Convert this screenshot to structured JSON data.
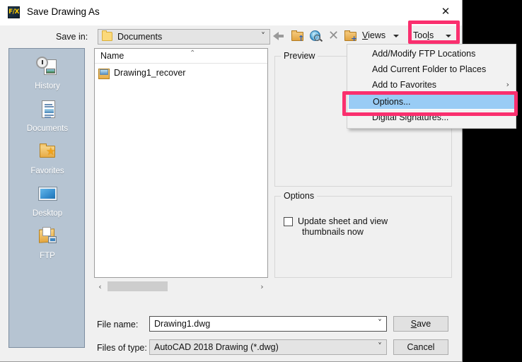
{
  "window": {
    "title": "Save Drawing As",
    "icon": "autocad-fx-icon",
    "close_label": "✕"
  },
  "saveIn": {
    "label": "Save in:",
    "value": "Documents",
    "chevron": "˅"
  },
  "toolbar": {
    "icons": [
      {
        "name": "back-icon",
        "title": "Back"
      },
      {
        "name": "up-one-level-icon",
        "title": "Up one level"
      },
      {
        "name": "search-web-icon",
        "title": "Search the Web"
      },
      {
        "name": "delete-icon",
        "title": "Delete"
      },
      {
        "name": "create-new-folder-icon",
        "title": "Create New Folder"
      }
    ],
    "views_label": "Views",
    "views_label_underline": "V",
    "views_label_rest": "iews",
    "tools_label": "Tools",
    "tools_label_pre": "Too",
    "tools_label_underline": "l",
    "tools_label_post": "s"
  },
  "places": {
    "items": [
      {
        "label": "History",
        "icon": "history-icon"
      },
      {
        "label": "Documents",
        "icon": "documents-icon"
      },
      {
        "label": "Favorites",
        "icon": "favorites-icon"
      },
      {
        "label": "Desktop",
        "icon": "desktop-icon"
      },
      {
        "label": "FTP",
        "icon": "ftp-icon"
      }
    ]
  },
  "filelist": {
    "column_header": "Name",
    "sort_indicator": "⌃",
    "rows": [
      {
        "name": "Drawing1_recover",
        "icon": "dwg-file-icon"
      }
    ],
    "scrollbar": {
      "left_arrow": "‹",
      "right_arrow": "›"
    }
  },
  "preview": {
    "group_title": "Preview"
  },
  "options": {
    "group_title": "Options",
    "checkbox_label_line1": "Update sheet and view",
    "checkbox_label_line2": "thumbnails now",
    "checkbox_checked": false
  },
  "bottom": {
    "file_name_label": "File name:",
    "file_name_value": "Drawing1.dwg",
    "file_type_label": "Files of type:",
    "file_type_value": "AutoCAD 2018 Drawing (*.dwg)",
    "save_button": "Save",
    "save_button_underline": "S",
    "save_button_rest": "ave",
    "cancel_button": "Cancel",
    "chevron": "˅"
  },
  "menu": {
    "items": [
      {
        "label": "Add/Modify FTP Locations",
        "submarker": "",
        "selected": false
      },
      {
        "label": "Add Current Folder to Places",
        "submarker": "",
        "selected": false
      },
      {
        "label": "Add to Favorites",
        "submarker": "›",
        "selected": false
      },
      {
        "label": "Options...",
        "submarker": "",
        "selected": true
      },
      {
        "label": "Digital Signatures...",
        "submarker": "",
        "selected": false
      }
    ]
  },
  "annotations": {
    "highlight_color": "#fa2f6e",
    "boxes": [
      {
        "target": "tools-dropdown-button"
      },
      {
        "target": "menu-item-options"
      }
    ]
  }
}
